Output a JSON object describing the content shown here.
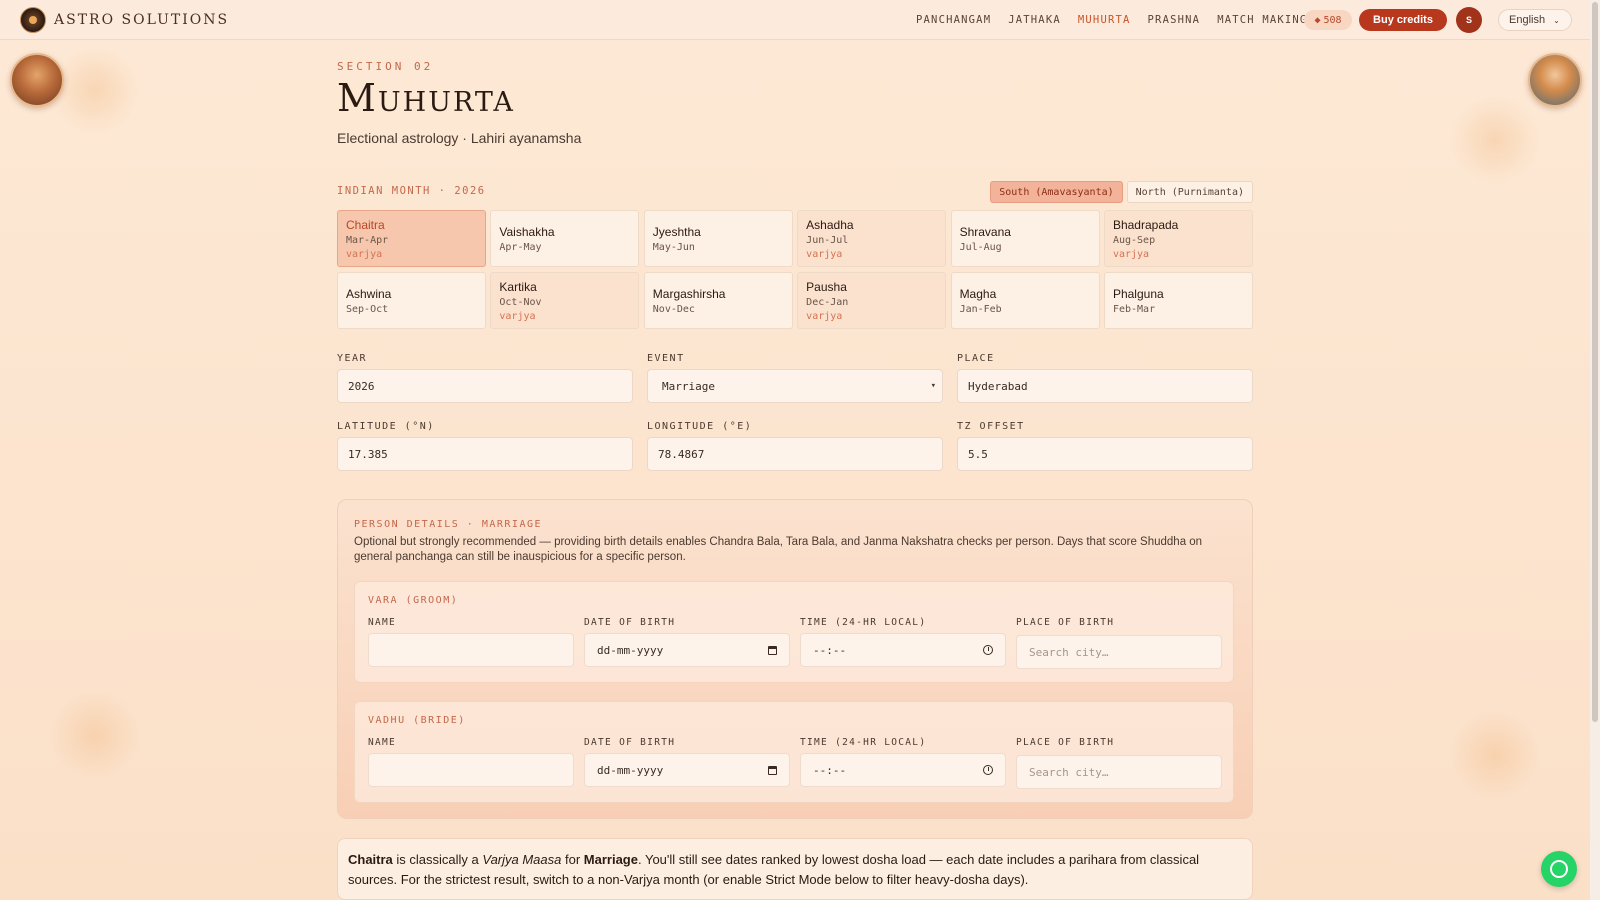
{
  "brand": {
    "name": "ASTRO SOLUTIONS"
  },
  "nav": {
    "items": [
      {
        "label": "PANCHANGAM",
        "active": false
      },
      {
        "label": "JATHAKA",
        "active": false
      },
      {
        "label": "MUHURTA",
        "active": true
      },
      {
        "label": "PRASHNA",
        "active": false
      },
      {
        "label": "MATCH MAKING",
        "active": false
      }
    ],
    "credits": "508",
    "credits_icon": "diamond-icon",
    "buy_label": "Buy credits",
    "avatar_initial": "S",
    "language": "English"
  },
  "header": {
    "section": "SECTION 02",
    "title": "Muhurta",
    "subtitle": "Electional astrology · Lahiri ayanamsha"
  },
  "month_picker": {
    "heading": "INDIAN MONTH · 2026",
    "toggles": [
      {
        "label": "South (Amavasyanta)",
        "active": true
      },
      {
        "label": "North (Purnimanta)",
        "active": false
      }
    ],
    "months": [
      {
        "name": "Chaitra",
        "range": "Mar-Apr",
        "tag": "varjya",
        "selected": true
      },
      {
        "name": "Vaishakha",
        "range": "Apr-May",
        "tag": "",
        "selected": false
      },
      {
        "name": "Jyeshtha",
        "range": "May-Jun",
        "tag": "",
        "selected": false
      },
      {
        "name": "Ashadha",
        "range": "Jun-Jul",
        "tag": "varjya",
        "selected": false
      },
      {
        "name": "Shravana",
        "range": "Jul-Aug",
        "tag": "",
        "selected": false
      },
      {
        "name": "Bhadrapada",
        "range": "Aug-Sep",
        "tag": "varjya",
        "selected": false
      },
      {
        "name": "Ashwina",
        "range": "Sep-Oct",
        "tag": "",
        "selected": false
      },
      {
        "name": "Kartika",
        "range": "Oct-Nov",
        "tag": "varjya",
        "selected": false
      },
      {
        "name": "Margashirsha",
        "range": "Nov-Dec",
        "tag": "",
        "selected": false
      },
      {
        "name": "Pausha",
        "range": "Dec-Jan",
        "tag": "varjya",
        "selected": false
      },
      {
        "name": "Magha",
        "range": "Jan-Feb",
        "tag": "",
        "selected": false
      },
      {
        "name": "Phalguna",
        "range": "Feb-Mar",
        "tag": "",
        "selected": false
      }
    ]
  },
  "form": {
    "year": {
      "label": "YEAR",
      "value": "2026"
    },
    "event": {
      "label": "EVENT",
      "value": "Marriage"
    },
    "place": {
      "label": "PLACE",
      "value": "Hyderabad"
    },
    "latitude": {
      "label": "LATITUDE (°N)",
      "value": "17.385"
    },
    "longitude": {
      "label": "LONGITUDE (°E)",
      "value": "78.4867"
    },
    "tz": {
      "label": "TZ OFFSET",
      "value": "5.5"
    }
  },
  "persons": {
    "title": "PERSON DETAILS · MARRIAGE",
    "description": "Optional but strongly recommended — providing birth details enables Chandra Bala, Tara Bala, and Janma Nakshatra checks per person. Days that score Shuddha on general panchanga can still be inauspicious for a specific person.",
    "field_labels": {
      "name": "NAME",
      "dob": "DATE OF BIRTH",
      "time": "TIME (24-HR LOCAL)",
      "place": "PLACE OF BIRTH"
    },
    "dob_placeholder": "dd-mm-yyyy",
    "time_placeholder": "--:--",
    "place_placeholder": "Search city…",
    "groom": {
      "title": "VARA (GROOM)",
      "name": ""
    },
    "bride": {
      "title": "VADHU (BRIDE)",
      "name": ""
    }
  },
  "notice": {
    "month": "Chaitra",
    "text1": " is classically a ",
    "term": "Varjya Maasa",
    "text2": " for ",
    "event": "Marriage",
    "text3": ". You'll still see dates ranked by lowest dosha load — each date includes a parihara from classical sources. For the strictest result, switch to a non-Varjya month (or enable Strict Mode below to filter heavy-dosha days)."
  },
  "colors": {
    "accent": "#b8381e",
    "label_accent": "#c4684a",
    "background": "#fde9d6",
    "chat": "#25d366"
  }
}
